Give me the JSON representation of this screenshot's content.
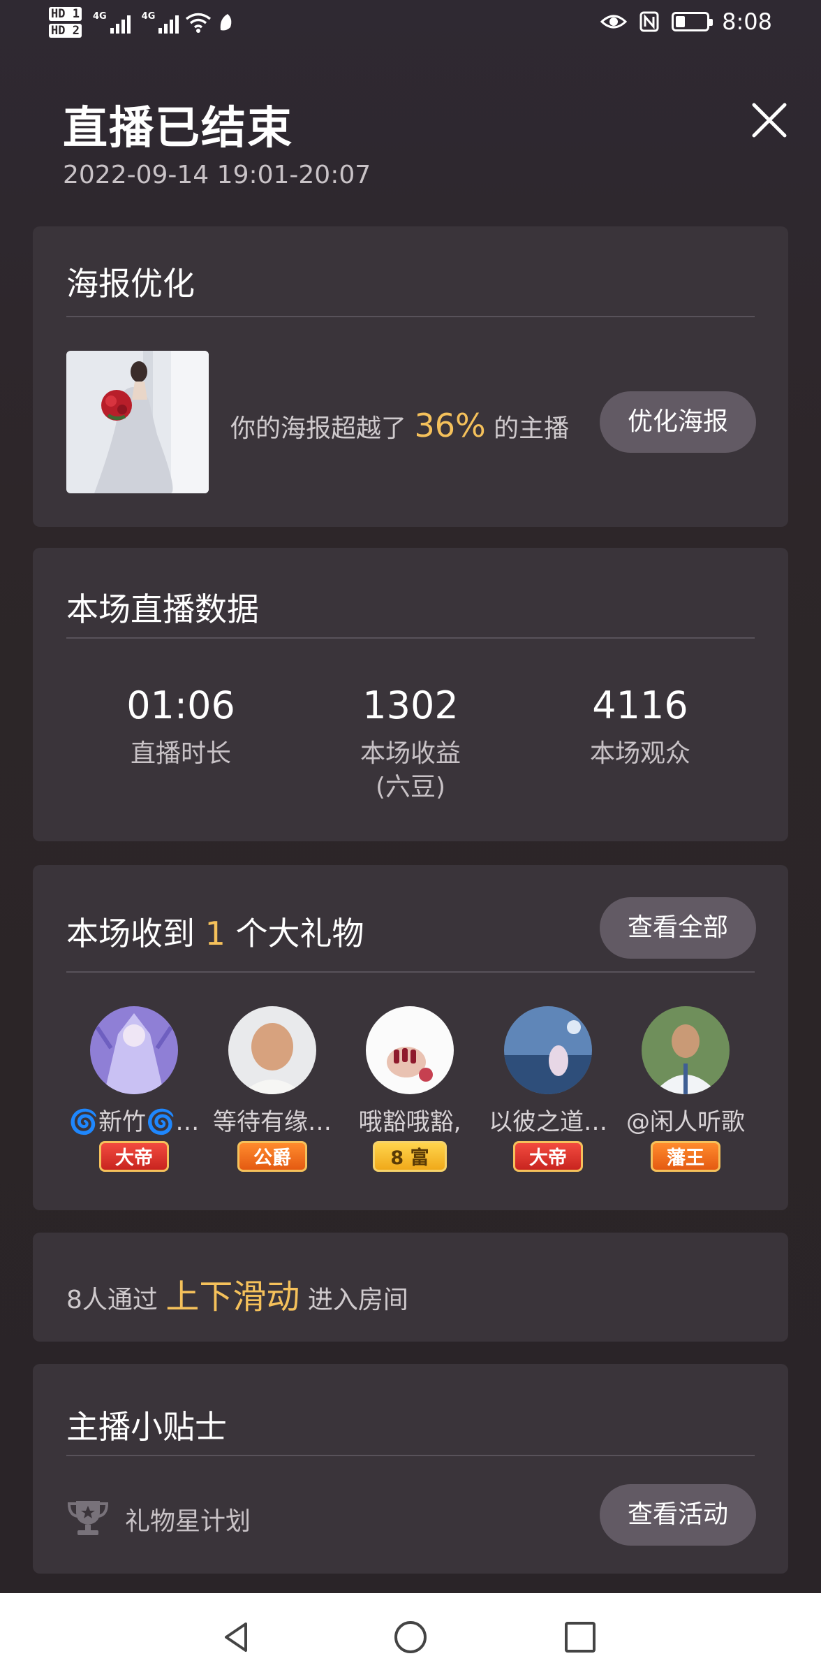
{
  "status_bar": {
    "hd1": "HD 1",
    "hd2": "HD 2",
    "net1": "4G",
    "net2": "4G",
    "time": "8:08",
    "battery_level": 0.3
  },
  "header": {
    "title": "直播已结束",
    "time_range": "2022-09-14 19:01-20:07"
  },
  "poster": {
    "title": "海报优化",
    "text_prefix": "你的海报超越了",
    "percent": "36%",
    "text_suffix": "的主播",
    "button": "优化海报"
  },
  "stats": {
    "title": "本场直播数据",
    "items": [
      {
        "value": "01:06",
        "label": "直播时长",
        "label2": ""
      },
      {
        "value": "1302",
        "label": "本场收益",
        "label2": "(六豆)"
      },
      {
        "value": "4116",
        "label": "本场观众",
        "label2": ""
      }
    ]
  },
  "gifts": {
    "title_prefix": "本场收到",
    "count": "1",
    "title_suffix": "个大礼物",
    "button": "查看全部",
    "users": [
      {
        "name": "🌀新竹🌀…",
        "badge": "大帝"
      },
      {
        "name": "等待有缘…",
        "badge": "公爵"
      },
      {
        "name": "哦豁哦豁,",
        "badge": "8 富"
      },
      {
        "name": "以彼之道…",
        "badge": "大帝"
      },
      {
        "name": "@闲人听歌",
        "badge": "藩王"
      }
    ]
  },
  "swipe": {
    "prefix": "8人通过",
    "highlight": "上下滑动",
    "suffix": "进入房间"
  },
  "tips": {
    "title": "主播小贴士",
    "item": "礼物星计划",
    "button": "查看活动"
  },
  "colors": {
    "accent": "#f5c15b",
    "card": "#3a343a",
    "pill": "#625a64"
  }
}
